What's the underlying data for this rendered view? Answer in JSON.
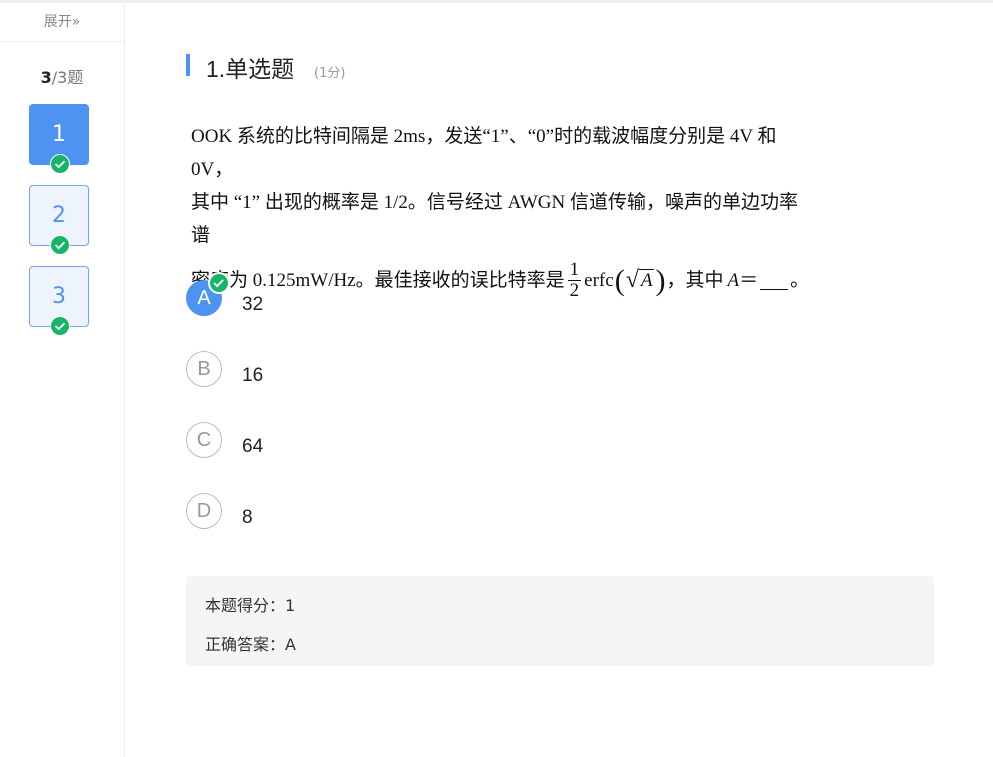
{
  "sidebar": {
    "expand_label": "展开",
    "expand_icon": "»",
    "counter_current": "3",
    "counter_rest": "/3题",
    "questions": [
      {
        "label": "1",
        "state": "active",
        "answered": true
      },
      {
        "label": "2",
        "state": "done",
        "answered": true
      },
      {
        "label": "3",
        "state": "done",
        "answered": true
      }
    ]
  },
  "question": {
    "title": "1.单选题",
    "score": "(1分)",
    "stem_line1": "OOK 系统的比特间隔是 2ms，发送“1”、“0”时的载波幅度分别是 4V 和 0V，",
    "stem_line2": "其中 “1” 出现的概率是 1/2。信号经过 AWGN 信道传输，噪声的单边功率谱",
    "stem_line3_prefix": "密度为 0.125mW/Hz。最佳接收的误比特率是",
    "frac_num": "1",
    "frac_den": "2",
    "func": "erfc",
    "sqrt_arg": "A",
    "stem_line3_suffix": "，其中",
    "var": "A",
    "eq": "＝",
    "end": "。",
    "options": [
      {
        "letter": "A",
        "text": "32",
        "selected": true
      },
      {
        "letter": "B",
        "text": "16",
        "selected": false
      },
      {
        "letter": "C",
        "text": "64",
        "selected": false
      },
      {
        "letter": "D",
        "text": "8",
        "selected": false
      }
    ]
  },
  "result": {
    "score_label": "本题得分：",
    "score_value": "1",
    "answer_label": "正确答案：",
    "answer_value": "A"
  },
  "colors": {
    "accent": "#4e93f2",
    "success": "#18b566"
  }
}
